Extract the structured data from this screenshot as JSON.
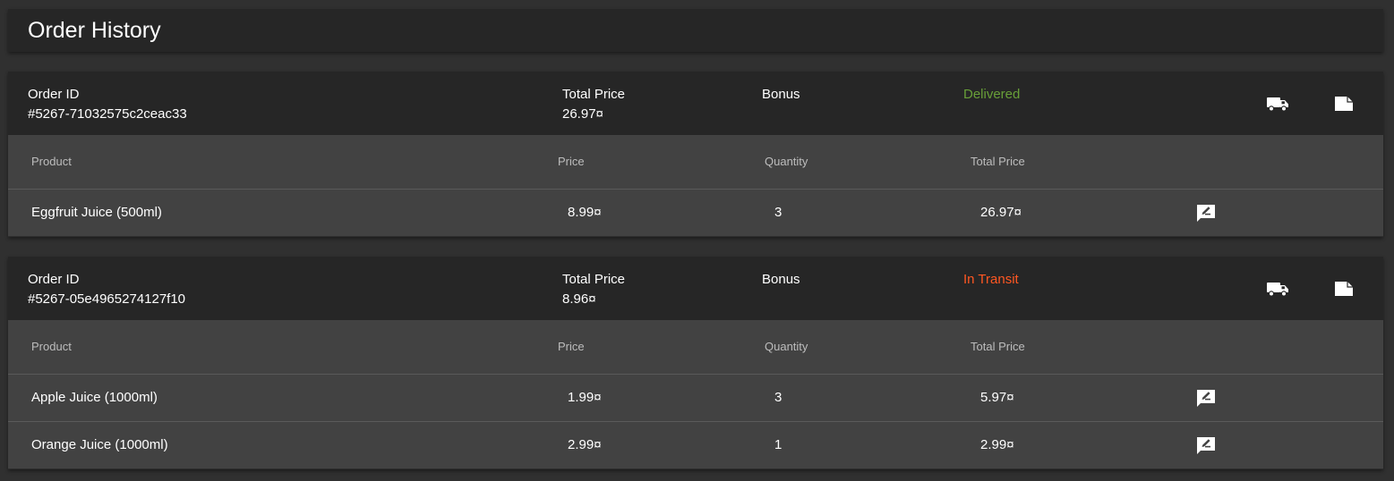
{
  "page": {
    "title": "Order History"
  },
  "labels": {
    "order_id": "Order ID",
    "total_price": "Total Price",
    "bonus": "Bonus",
    "col_product": "Product",
    "col_price": "Price",
    "col_quantity": "Quantity",
    "col_total_price": "Total Price"
  },
  "colors": {
    "delivered": "#689f38",
    "in_transit": "#ff5722"
  },
  "orders": [
    {
      "id": "#5267-71032575c2ceac33",
      "total_price": "26.97¤",
      "bonus": "",
      "status": "Delivered",
      "products": [
        {
          "name": "Eggfruit Juice (500ml)",
          "price": "8.99¤",
          "quantity": "3",
          "total": "26.97¤"
        }
      ]
    },
    {
      "id": "#5267-05e4965274127f10",
      "total_price": "8.96¤",
      "bonus": "",
      "status": "In Transit",
      "products": [
        {
          "name": "Apple Juice (1000ml)",
          "price": "1.99¤",
          "quantity": "3",
          "total": "5.97¤"
        },
        {
          "name": "Orange Juice (1000ml)",
          "price": "2.99¤",
          "quantity": "1",
          "total": "2.99¤"
        }
      ]
    }
  ]
}
